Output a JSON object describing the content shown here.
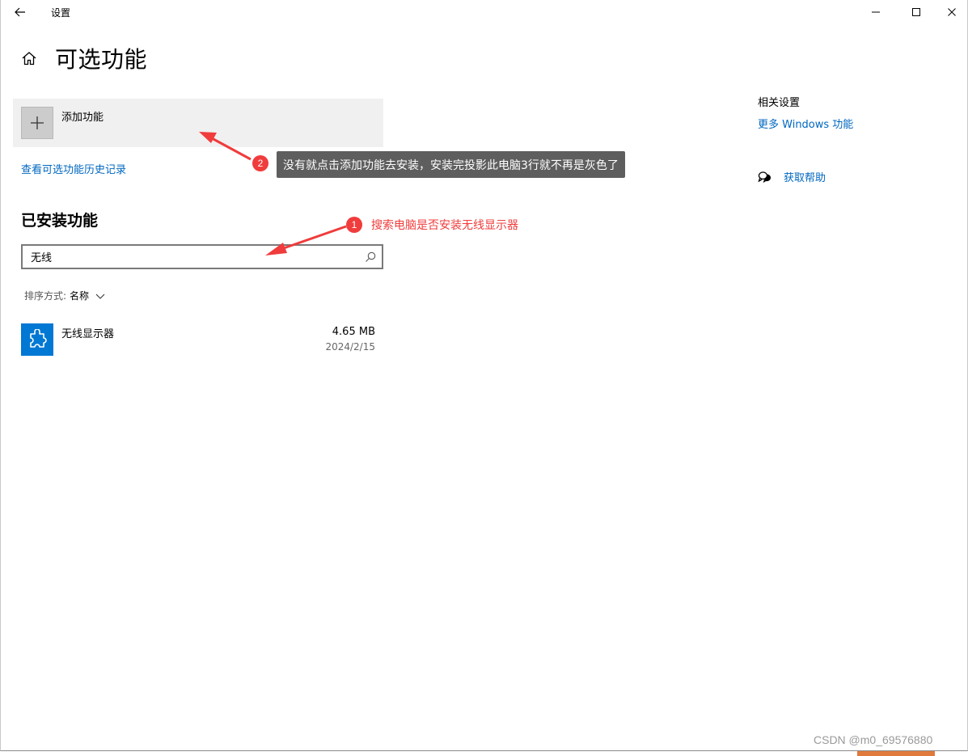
{
  "window": {
    "title": "设置",
    "back_icon": "back-arrow-icon",
    "controls": [
      "minimize-icon",
      "maximize-icon",
      "close-icon"
    ]
  },
  "header": {
    "home_icon": "home-icon",
    "title": "可选功能"
  },
  "add_feature": {
    "label": "添加功能",
    "icon": "plus-icon"
  },
  "history_link": "查看可选功能历史记录",
  "installed": {
    "title": "已安装功能",
    "search": {
      "value": "无线",
      "icon": "search-icon"
    },
    "sort": {
      "label": "排序方式:",
      "value": "名称"
    },
    "items": [
      {
        "name": "无线显示器",
        "size": "4.65 MB",
        "date": "2024/2/15",
        "icon": "puzzle-piece-icon",
        "icon_color": "#0078d4"
      }
    ]
  },
  "related": {
    "title": "相关设置",
    "link": "更多 Windows 功能",
    "help_label": "获取帮助",
    "help_icon": "chat-help-icon"
  },
  "annotations": [
    {
      "number": "1",
      "text": "搜索电脑是否安装无线显示器",
      "color": "#f03c3c"
    },
    {
      "number": "2",
      "text": "没有就点击添加功能去安装，安装完投影此电脑3行就不再是灰色了",
      "color": "#5e5e5e"
    }
  ],
  "watermark": "CSDN @m0_69576880",
  "colors": {
    "link": "#0067c0",
    "accent": "#0078d4",
    "annotation_red": "#f03c3c"
  }
}
